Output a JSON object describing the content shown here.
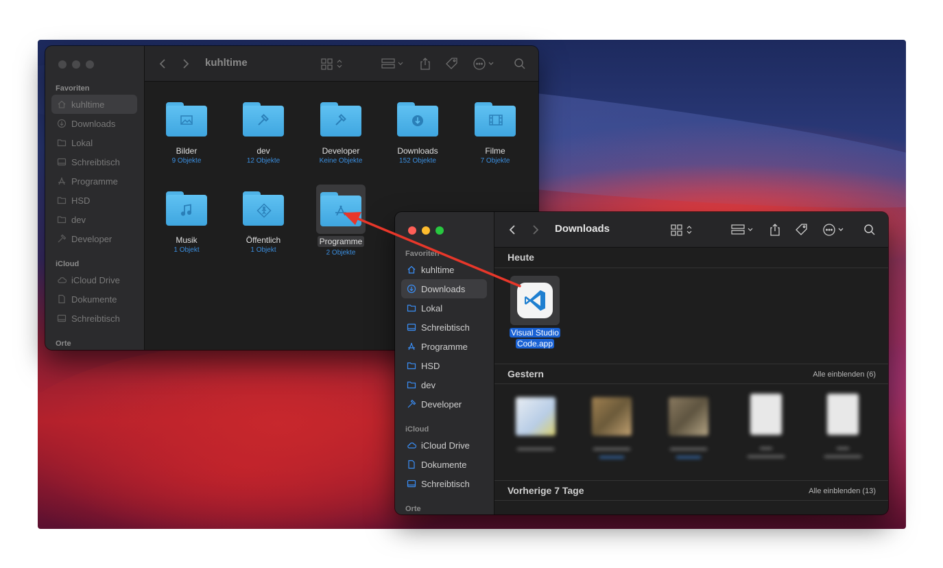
{
  "window_back": {
    "title": "kuhltime",
    "sidebar": {
      "favorites_header": "Favoriten",
      "items": [
        {
          "label": "kuhltime",
          "icon": "home-icon"
        },
        {
          "label": "Downloads",
          "icon": "download-circle-icon"
        },
        {
          "label": "Lokal",
          "icon": "folder-icon"
        },
        {
          "label": "Schreibtisch",
          "icon": "desktop-icon"
        },
        {
          "label": "Programme",
          "icon": "apps-icon"
        },
        {
          "label": "HSD",
          "icon": "folder-icon"
        },
        {
          "label": "dev",
          "icon": "folder-icon"
        },
        {
          "label": "Developer",
          "icon": "hammer-icon"
        }
      ],
      "icloud_header": "iCloud",
      "icloud_items": [
        {
          "label": "iCloud Drive",
          "icon": "cloud-icon"
        },
        {
          "label": "Dokumente",
          "icon": "document-icon"
        },
        {
          "label": "Schreibtisch",
          "icon": "desktop-icon"
        }
      ],
      "places_header": "Orte"
    },
    "folders": [
      {
        "name": "Bilder",
        "count": "9 Objekte",
        "icon": "image-icon"
      },
      {
        "name": "dev",
        "count": "12 Objekte",
        "icon": "hammer-icon"
      },
      {
        "name": "Developer",
        "count": "Keine Objekte",
        "icon": "hammer-icon"
      },
      {
        "name": "Downloads",
        "count": "152 Objekte",
        "icon": "download-icon"
      },
      {
        "name": "Filme",
        "count": "7 Objekte",
        "icon": "film-icon"
      },
      {
        "name": "Musik",
        "count": "1 Objekt",
        "icon": "music-icon"
      },
      {
        "name": "Öffentlich",
        "count": "1 Objekt",
        "icon": "public-icon"
      },
      {
        "name": "Programme",
        "count": "2 Objekte",
        "icon": "apps-icon"
      }
    ]
  },
  "window_front": {
    "title": "Downloads",
    "sidebar": {
      "favorites_header": "Favoriten",
      "items": [
        {
          "label": "kuhltime",
          "icon": "home-icon"
        },
        {
          "label": "Downloads",
          "icon": "download-circle-icon"
        },
        {
          "label": "Lokal",
          "icon": "folder-icon"
        },
        {
          "label": "Schreibtisch",
          "icon": "desktop-icon"
        },
        {
          "label": "Programme",
          "icon": "apps-icon"
        },
        {
          "label": "HSD",
          "icon": "folder-icon"
        },
        {
          "label": "dev",
          "icon": "folder-icon"
        },
        {
          "label": "Developer",
          "icon": "hammer-icon"
        }
      ],
      "icloud_header": "iCloud",
      "icloud_items": [
        {
          "label": "iCloud Drive",
          "icon": "cloud-icon"
        },
        {
          "label": "Dokumente",
          "icon": "document-icon"
        },
        {
          "label": "Schreibtisch",
          "icon": "desktop-icon"
        }
      ],
      "places_header": "Orte"
    },
    "sections": {
      "today": "Heute",
      "yesterday": "Gestern",
      "yesterday_show_all": "Alle einblenden (6)",
      "last7": "Vorherige 7 Tage",
      "last7_show_all": "Alle einblenden (13)"
    },
    "app_item": {
      "line1": "Visual Studio",
      "line2": "Code.app",
      "icon": "vscode-icon"
    }
  },
  "colors": {
    "accent": "#3a8ef6",
    "close": "#ff5f57",
    "minimize": "#febc2e",
    "zoom": "#28c840",
    "drag_arrow": "#e8372a"
  }
}
